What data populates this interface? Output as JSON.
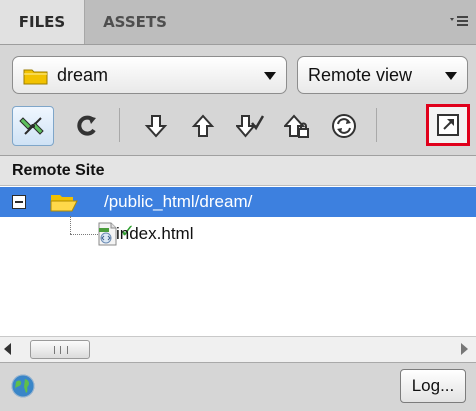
{
  "tabs": [
    {
      "label": "FILES"
    },
    {
      "label": "ASSETS"
    }
  ],
  "site": {
    "selected": "dream",
    "icon": "folder-icon"
  },
  "view": {
    "selected": "Remote view"
  },
  "toolbar": {
    "buttons": [
      {
        "name": "connect",
        "icon": "connect-icon"
      },
      {
        "name": "refresh",
        "icon": "refresh-icon"
      },
      {
        "name": "get",
        "icon": "get-arrow-icon"
      },
      {
        "name": "put",
        "icon": "put-arrow-icon"
      },
      {
        "name": "check-out",
        "icon": "check-out-icon"
      },
      {
        "name": "check-in",
        "icon": "check-in-icon"
      },
      {
        "name": "synchronize",
        "icon": "synchronize-icon"
      },
      {
        "name": "expand",
        "icon": "expand-icon"
      }
    ],
    "highlight_color": "#e0001b"
  },
  "tree": {
    "header": "Remote Site",
    "items": [
      {
        "label": "/public_html/dream/",
        "type": "folder",
        "selected": true
      },
      {
        "label": "index.html",
        "type": "file",
        "checked_out": true
      }
    ],
    "selected_color": "#3d80df"
  },
  "statusbar": {
    "log_label": "Log...",
    "icon": "globe-icon"
  }
}
